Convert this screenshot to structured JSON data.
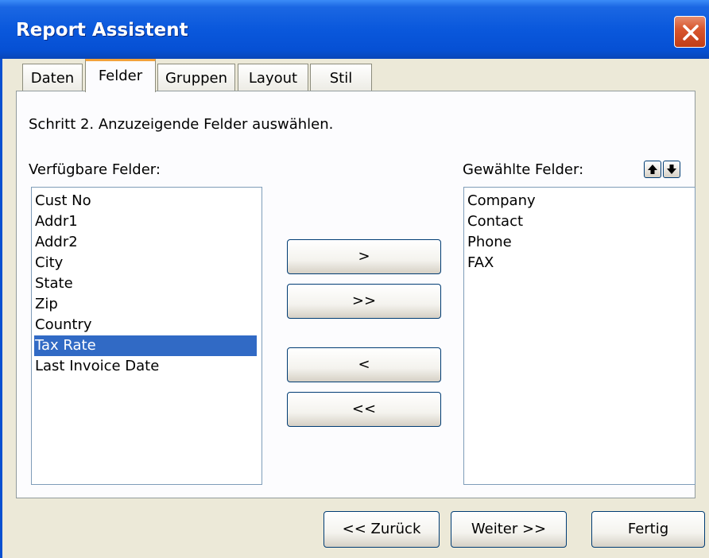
{
  "window": {
    "title": "Report Assistent"
  },
  "tabs": [
    {
      "label": "Daten"
    },
    {
      "label": "Felder"
    },
    {
      "label": "Gruppen"
    },
    {
      "label": "Layout"
    },
    {
      "label": "Stil"
    }
  ],
  "active_tab": "Felder",
  "step_text": "Schritt 2. Anzuzeigende Felder auswählen.",
  "available": {
    "label": "Verfügbare Felder:",
    "items": [
      "Cust No",
      "Addr1",
      "Addr2",
      "City",
      "State",
      "Zip",
      "Country",
      "Tax Rate",
      "Last Invoice Date"
    ],
    "selected": "Tax Rate"
  },
  "chosen": {
    "label": "Gewählte Felder:",
    "items": [
      "Company",
      "Contact",
      "Phone",
      "FAX"
    ]
  },
  "move_buttons": {
    "add_one": ">",
    "add_all": ">>",
    "remove_one": "<",
    "remove_all": "<<"
  },
  "footer": {
    "back": "<< Zurück",
    "next": "Weiter >>",
    "finish": "Fertig"
  },
  "icons": {
    "close": "close-icon",
    "move_up": "arrow-up-icon",
    "move_down": "arrow-down-icon"
  },
  "colors": {
    "titlebar": "#0a58dc",
    "close_button": "#d8572f",
    "selection": "#316ac5",
    "active_tab_accent": "#f3a23b",
    "dialog_bg": "#ece9d8"
  }
}
